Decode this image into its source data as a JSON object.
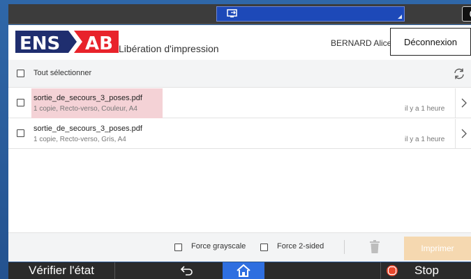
{
  "system_bar": {
    "center_icon": "monitor-arrow-icon",
    "right_icon": "moon-icon"
  },
  "header": {
    "logo_text": "ENS AB",
    "logo_colors": {
      "background": "#1f2e6f",
      "accent": "#e8232b"
    },
    "title": "Libération d'impression",
    "user_name": "BERNARD Alice",
    "logout_label": "Déconnexion"
  },
  "select_bar": {
    "select_all_label": "Tout sélectionner",
    "refresh_icon": "refresh-icon"
  },
  "jobs": [
    {
      "name": "sortie_de_secours_3_poses.pdf",
      "details": "1 copie, Recto-verso, Couleur, A4",
      "time": "il y a 1 heure",
      "highlighted": true
    },
    {
      "name": "sortie_de_secours_3_poses.pdf",
      "details": "1 copie, Recto-verso, Gris, A4",
      "time": "il y a 1 heure",
      "highlighted": false
    }
  ],
  "toolbar": {
    "force_grayscale_label": "Force grayscale",
    "force_2sided_label": "Force 2-sided",
    "print_label": "Imprimer",
    "print_color": "#f5d8b0"
  },
  "navbar": {
    "status_label": "Vérifier l'état",
    "stop_label": "Stop",
    "home_color": "#2f6fe0",
    "stop_color": "#e8462b"
  }
}
